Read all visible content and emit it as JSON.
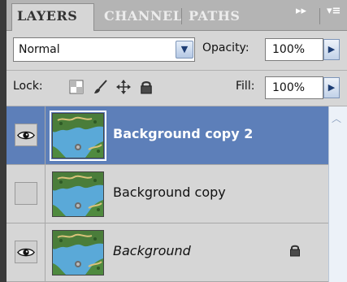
{
  "tabs": [
    {
      "label": "LAYERS",
      "active": true
    },
    {
      "label": "CHANNEL",
      "active": false
    },
    {
      "label": "PATHS",
      "active": false
    }
  ],
  "tab_controls": {
    "expand": "▸▸",
    "menu": "▾≡"
  },
  "blend_mode": {
    "value": "Normal"
  },
  "opacity": {
    "label": "Opacity:",
    "value": "100%"
  },
  "lock": {
    "label": "Lock:"
  },
  "fill": {
    "label": "Fill:",
    "value": "100%"
  },
  "layers": [
    {
      "name": "Background copy 2",
      "visible": true,
      "selected": true,
      "locked": false,
      "italic": false
    },
    {
      "name": "Background copy",
      "visible": false,
      "selected": false,
      "locked": false,
      "italic": false
    },
    {
      "name": "Background",
      "visible": true,
      "selected": false,
      "locked": true,
      "italic": true
    }
  ],
  "colors": {
    "selected_row": "#5d7fb9",
    "panel": "#d6d6d6",
    "tabbar": "#b4b4b4"
  }
}
